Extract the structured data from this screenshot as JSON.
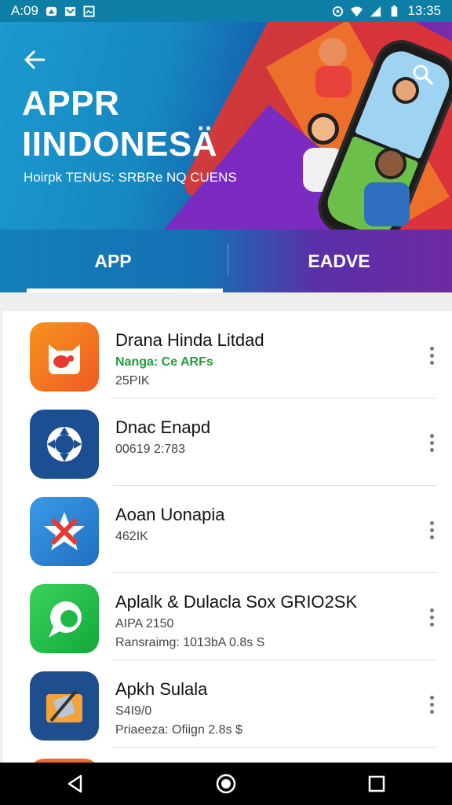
{
  "status_bar": {
    "time": "A:09",
    "clock": "13:35"
  },
  "header": {
    "title_line1": "APPR",
    "title_line2": "IINDONESÄ",
    "subtitle": "Hoirpk TENUS: SRBRe NQ CUENS"
  },
  "tabs": [
    {
      "label": "APP",
      "active": true
    },
    {
      "label": "EADVE",
      "active": false
    }
  ],
  "apps": [
    {
      "name": "Drana Hinda Litdad",
      "line2": "Nanga: Ce ARFs",
      "line2_style": "green",
      "line3": "25PIK",
      "icon": "cat-mascot-icon",
      "color": "#f27b1f"
    },
    {
      "name": "Dnac Enapd",
      "line2": "00619  2:783",
      "line3": "",
      "icon": "refresh-circle-icon",
      "color": "#1c4f91"
    },
    {
      "name": "Aoan Uonapia",
      "line2": "462IK",
      "line3": "",
      "icon": "star-cross-icon",
      "color": "#2f86d1"
    },
    {
      "name": "Aplalk & Dulacla Sox GRIO2SK",
      "line2": "AIPA 2150",
      "line3": "Ransraimg: 1013bA 0.8s S",
      "icon": "phone-bubble-icon",
      "color": "#20b847"
    },
    {
      "name": "Apkh Sulala",
      "line2": "S4I9/0",
      "line3": "Priaeeza: Ofiign 2.8s $",
      "icon": "folder-tools-icon",
      "color": "#1f4e8f"
    }
  ]
}
